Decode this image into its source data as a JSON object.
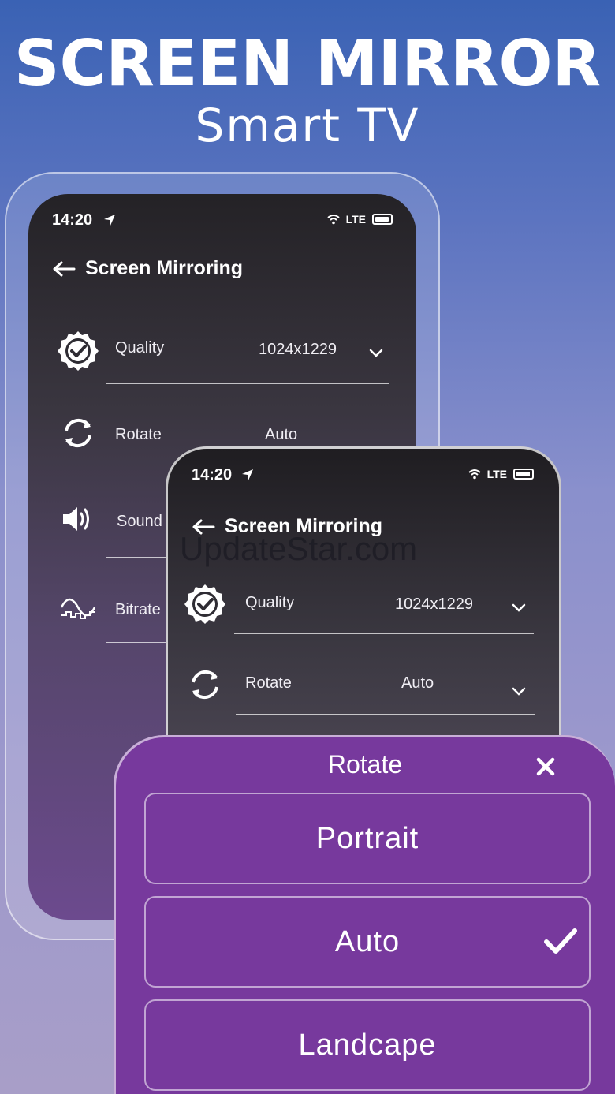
{
  "promo": {
    "headline": "SCREEN MIRROR",
    "subheadline": "Smart TV"
  },
  "status_bar": {
    "time": "14:20",
    "network": "LTE"
  },
  "screen": {
    "title": "Screen Mirroring"
  },
  "settings": [
    {
      "label": "Quality",
      "value": "1024x1229",
      "icon": "quality-badge-icon"
    },
    {
      "label": "Rotate",
      "value": "Auto",
      "icon": "rotate-icon"
    },
    {
      "label": "Sound",
      "value": "",
      "icon": "speaker-icon"
    },
    {
      "label": "Bitrate",
      "value": "",
      "icon": "bitrate-wave-icon"
    }
  ],
  "watermark": "UpdateStar.com",
  "rotate_sheet": {
    "title": "Rotate",
    "options": [
      "Portrait",
      "Auto",
      "Landcape"
    ],
    "selected": "Auto"
  },
  "colors": {
    "sheet": "#77399d",
    "bg_top": "#3a62b4",
    "bg_bottom": "#a89ec8"
  }
}
